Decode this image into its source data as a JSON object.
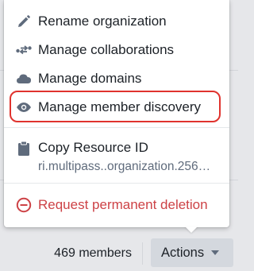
{
  "menu": {
    "items": [
      {
        "label": "Rename organization",
        "icon": "pencil-icon"
      },
      {
        "label": "Manage collaborations",
        "icon": "link-arrows-icon"
      },
      {
        "label": "Manage domains",
        "icon": "cloud-icon"
      },
      {
        "label": "Manage member discovery",
        "icon": "eye-icon",
        "highlighted": true
      }
    ],
    "copy_resource": {
      "label": "Copy Resource ID",
      "resource_id": "ri.multipass..organization.256…",
      "icon": "clipboard-icon"
    },
    "danger_item": {
      "label": "Request permanent deletion",
      "icon": "remove-circle-icon"
    }
  },
  "footer": {
    "member_count": "469 members",
    "actions_label": "Actions"
  },
  "colors": {
    "highlight_ring": "#e0332e",
    "danger": "#cd4246",
    "icon_gray": "#5f6b7c",
    "button_bg": "#d4d8de"
  }
}
